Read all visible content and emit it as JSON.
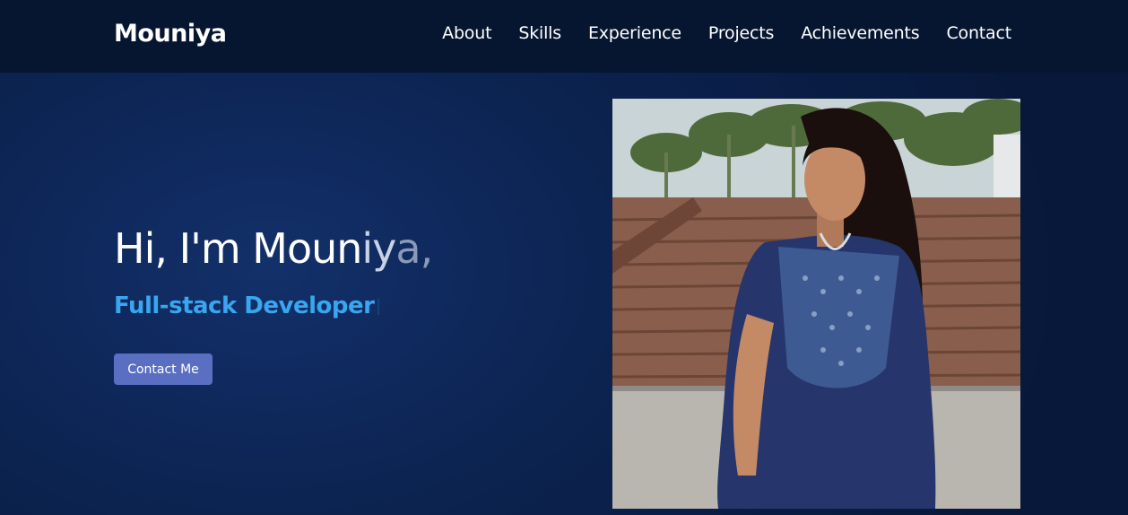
{
  "header": {
    "brand": "Mouniya",
    "nav": [
      {
        "label": "About"
      },
      {
        "label": "Skills"
      },
      {
        "label": "Experience"
      },
      {
        "label": "Projects"
      },
      {
        "label": "Achievements"
      },
      {
        "label": "Contact"
      }
    ]
  },
  "hero": {
    "greeting_main": "Hi, I'm Moun",
    "greeting_fade1": "iy",
    "greeting_fade2": "a,",
    "role": "Full-stack Developer",
    "cta_label": "Contact Me"
  },
  "colors": {
    "accent": "#39a6f0",
    "button": "#5a6fc2",
    "nav_bg": "#061530"
  }
}
